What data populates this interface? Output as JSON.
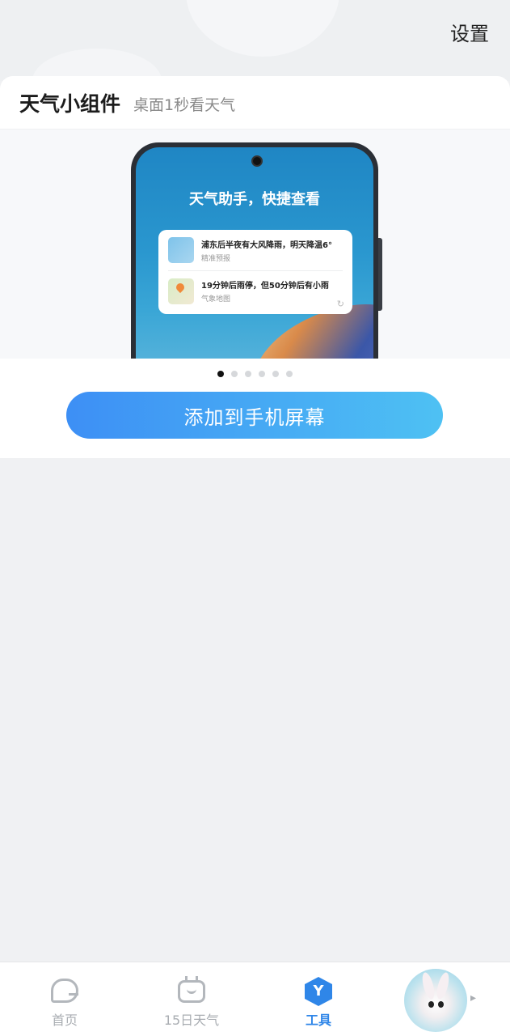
{
  "header": {
    "settings_label": "设置"
  },
  "card": {
    "title": "天气小组件",
    "subtitle": "桌面1秒看天气",
    "preview": {
      "screen_title": "天气助手，快捷查看",
      "widget_rows": [
        {
          "main": "浦东后半夜有大风降雨，明天降温6°",
          "sub": "精准预报",
          "thumb": "rain-thumbnail"
        },
        {
          "main": "19分钟后雨停，但50分钟后有小雨",
          "sub": "气象地图",
          "thumb": "map-thumbnail"
        }
      ],
      "refresh_icon": "↻"
    },
    "pager": {
      "count": 6,
      "active_index": 0
    },
    "add_button_label": "添加到手机屏幕"
  },
  "nav": {
    "items": [
      {
        "label": "首页",
        "icon": "home-icon",
        "active": false
      },
      {
        "label": "15日天气",
        "icon": "calendar-icon",
        "active": false
      },
      {
        "label": "工具",
        "icon": "tools-icon",
        "active": true
      }
    ],
    "tool_icon_glyph": "Y",
    "chevron": "▸",
    "active_color": "#2f86e8",
    "inactive_color": "#a9adb2"
  }
}
